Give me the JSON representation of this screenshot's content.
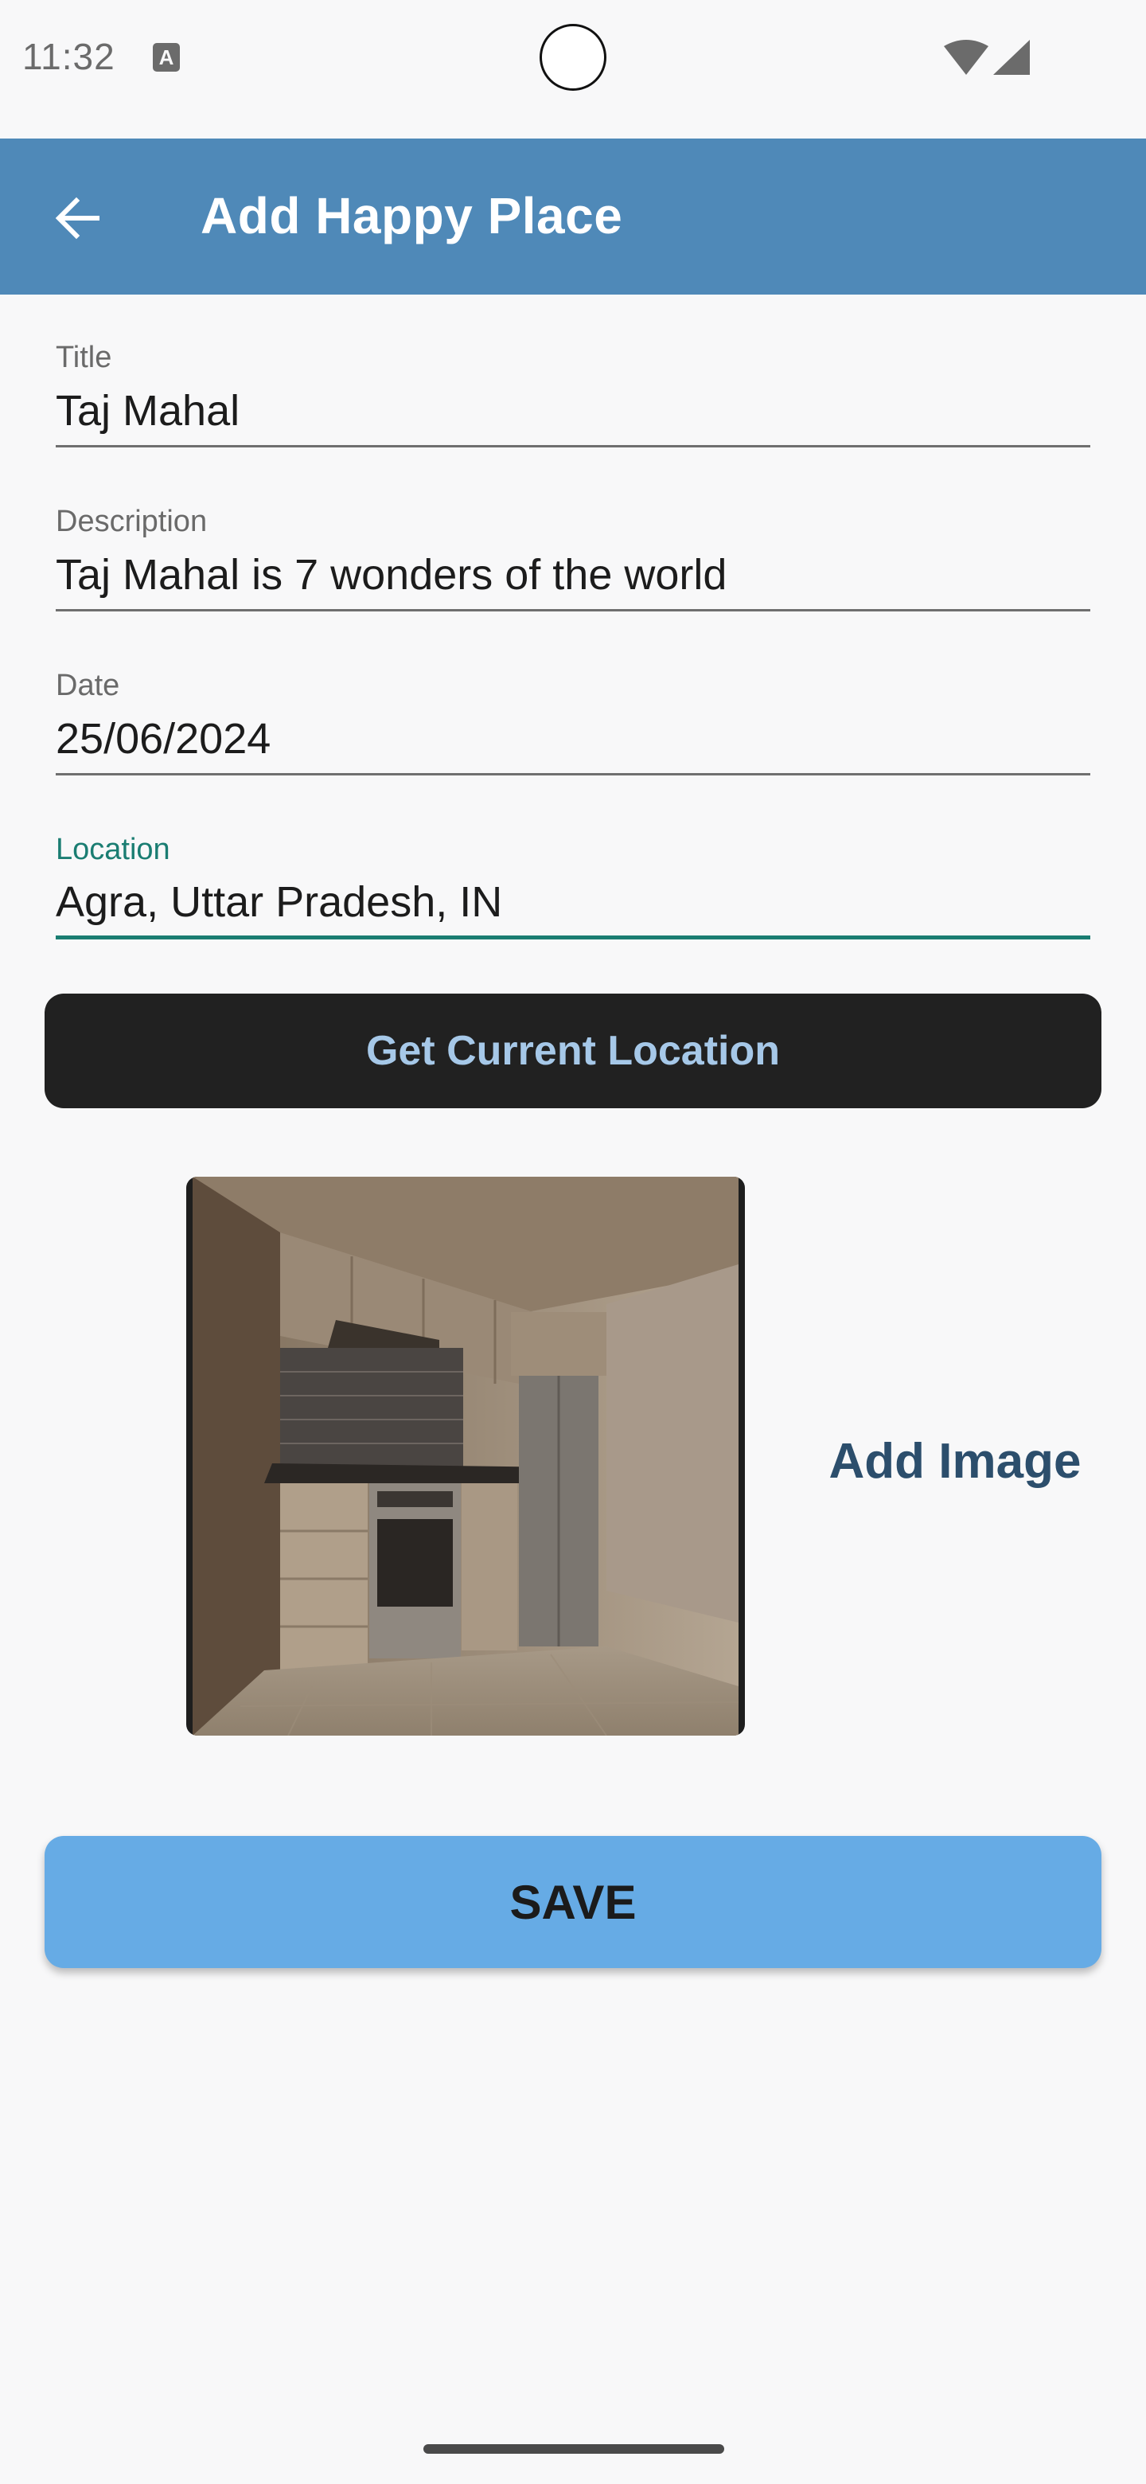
{
  "status_bar": {
    "time": "11:32",
    "notification_icon": "a-icon",
    "wifi_icon": "wifi-icon",
    "signal_icon": "signal-icon"
  },
  "app_bar": {
    "back_icon": "arrow-back-icon",
    "title": "Add Happy Place",
    "color": "#4f89b8"
  },
  "form": {
    "title": {
      "label": "Title",
      "value": "Taj Mahal"
    },
    "description": {
      "label": "Description",
      "value": "Taj Mahal is 7 wonders of the world"
    },
    "date": {
      "label": "Date",
      "value": "25/06/2024"
    },
    "location": {
      "label": "Location",
      "value": "Agra, Uttar Pradesh, IN",
      "focused": true,
      "accent": "#1a7d72"
    }
  },
  "get_location_button": {
    "label": "Get Current Location"
  },
  "image": {
    "add_label": "Add Image"
  },
  "save_button": {
    "label": "SAVE",
    "color": "#66abe5"
  }
}
